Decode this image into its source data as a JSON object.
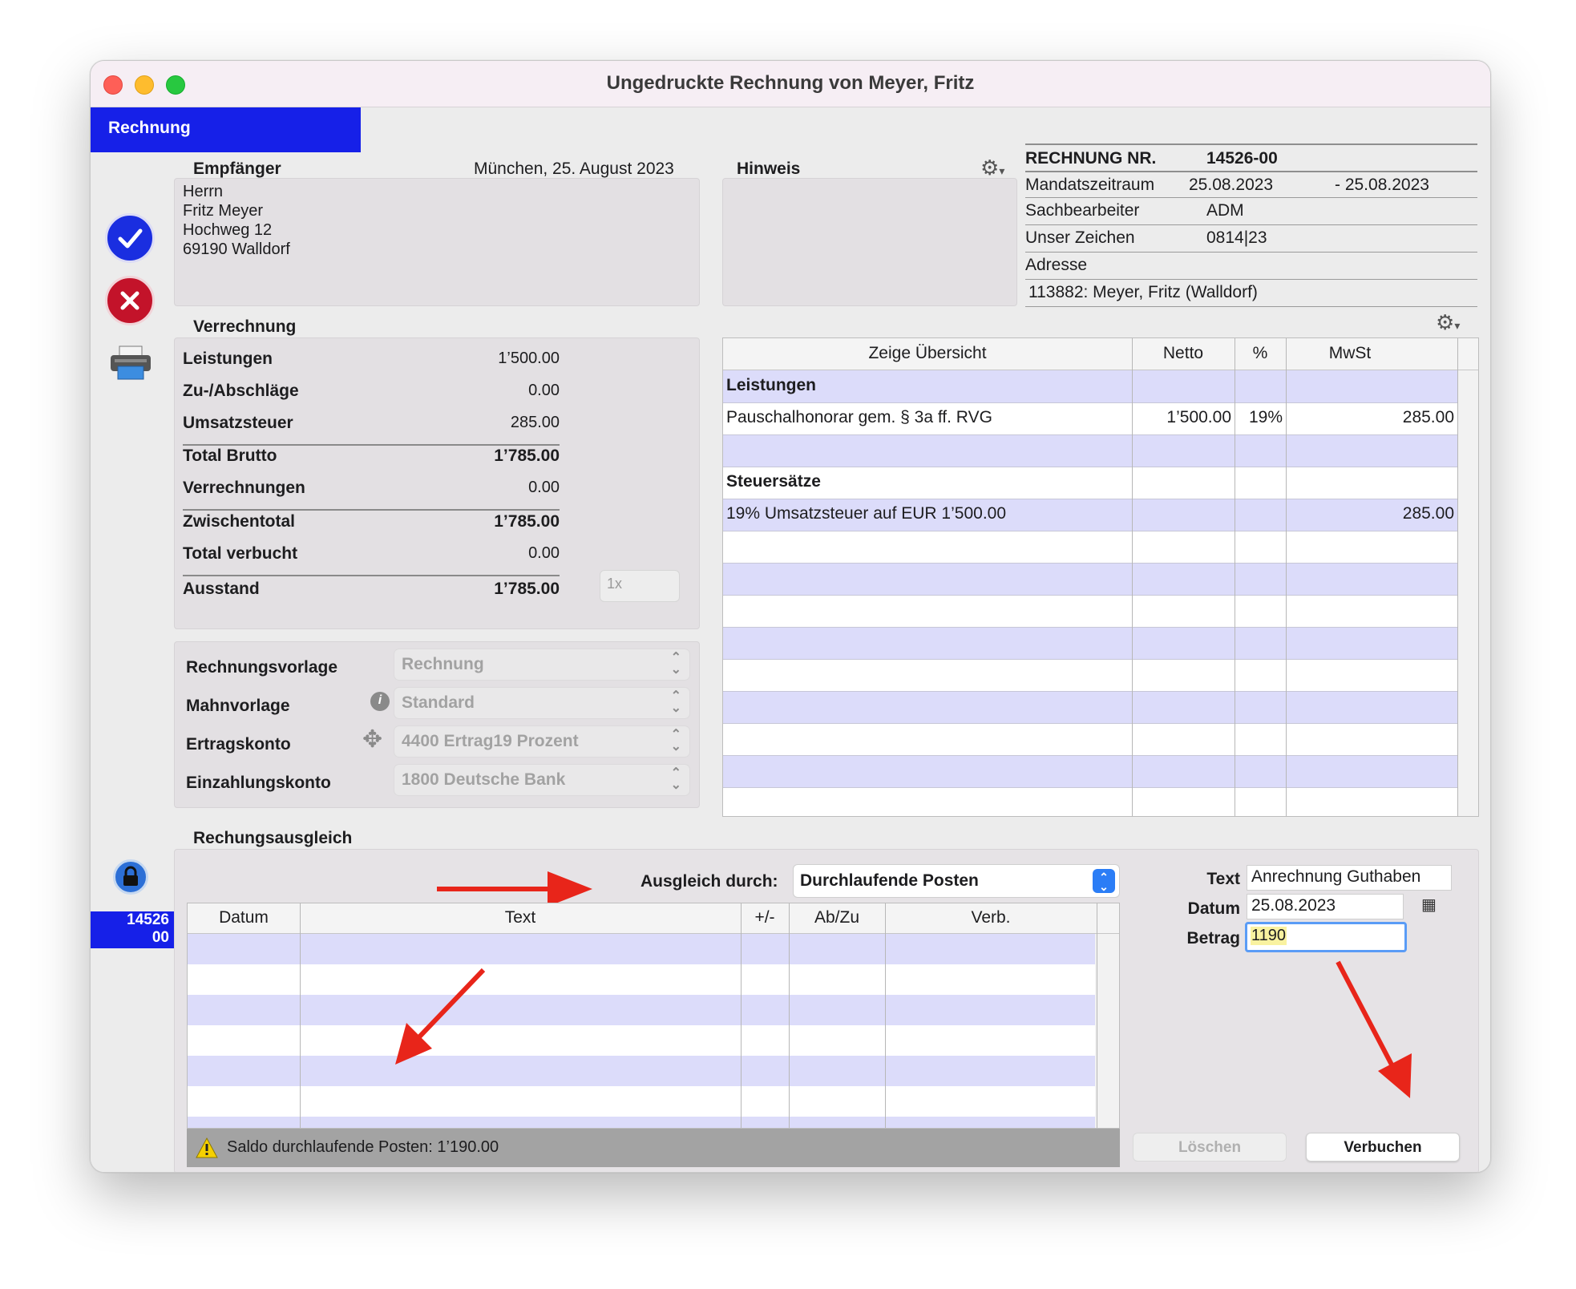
{
  "window": {
    "title": "Ungedruckte Rechnung von Meyer, Fritz",
    "tab_label": "Rechnung",
    "colors": {
      "accent": "#1620e8",
      "row_lavender": "#dcdcfa",
      "arrow": "#e8251a"
    }
  },
  "recipient": {
    "heading": "Empfänger",
    "date_line": "München, 25. August 2023",
    "lines": [
      "Herrn",
      "Fritz Meyer",
      "Hochweg 12",
      "69190 Walldorf"
    ]
  },
  "hinweis": {
    "heading": "Hinweis"
  },
  "invoice_info": {
    "number_label": "RECHNUNG NR.",
    "number_value": "14526-00",
    "mandate_label": "Mandatszeitraum",
    "mandate_from": "25.08.2023",
    "mandate_to": "- 25.08.2023",
    "clerk_label": "Sachbearbeiter",
    "clerk_value": "ADM",
    "ref_label": "Unser Zeichen",
    "ref_value": "0814|23",
    "address_label": "Adresse",
    "address_value": "113882: Meyer, Fritz (Walldorf)"
  },
  "verrechnung": {
    "heading": "Verrechnung",
    "rows": [
      {
        "label": "Leistungen",
        "value": "1’500.00"
      },
      {
        "label": "Zu-/Abschläge",
        "value": "0.00"
      },
      {
        "label": "Umsatzsteuer",
        "value": "285.00"
      },
      {
        "label": "Total Brutto",
        "value": "1’785.00"
      },
      {
        "label": "Verrechnungen",
        "value": "0.00"
      },
      {
        "label": "Zwischentotal",
        "value": "1’785.00"
      },
      {
        "label": "Total verbucht",
        "value": "0.00"
      },
      {
        "label": "Ausstand",
        "value": "1’785.00"
      }
    ],
    "count_placeholder": "1x"
  },
  "settings": {
    "rows": [
      {
        "label": "Rechnungsvorlage",
        "value": "Rechnung"
      },
      {
        "label": "Mahnvorlage",
        "value": "Standard"
      },
      {
        "label": "Ertragskonto",
        "value": "4400 Ertrag19 Prozent"
      },
      {
        "label": "Einzahlungskonto",
        "value": "1800 Deutsche Bank"
      }
    ]
  },
  "overview": {
    "columns": [
      "Zeige Übersicht",
      "Netto",
      "%",
      "MwSt"
    ],
    "section_services": "Leistungen",
    "service_row": {
      "text": "Pauschalhonorar gem. § 3a ff. RVG",
      "netto": "1’500.00",
      "percent": "19%",
      "mwst": "285.00"
    },
    "section_tax": "Steuersätze",
    "tax_row": {
      "text": "19% Umsatzsteuer auf EUR 1’500.00",
      "mwst": "285.00"
    }
  },
  "ausgleich": {
    "heading": "Rechungsausgleich",
    "method_label": "Ausgleich durch:",
    "method_value": "Durchlaufende Posten",
    "columns": [
      "Datum",
      "Text",
      "+/-",
      "Ab/Zu",
      "Verb."
    ],
    "status_text": "Saldo durchlaufende Posten: 1’190.00",
    "text_label": "Text",
    "text_value": "Anrechnung Guthaben",
    "date_label": "Datum",
    "date_value": "25.08.2023",
    "amount_label": "Betrag",
    "amount_value": "1190",
    "delete_button": "Löschen",
    "post_button": "Verbuchen"
  },
  "sidebar": {
    "invoice_no_line1": "14526",
    "invoice_no_line2": "00"
  }
}
